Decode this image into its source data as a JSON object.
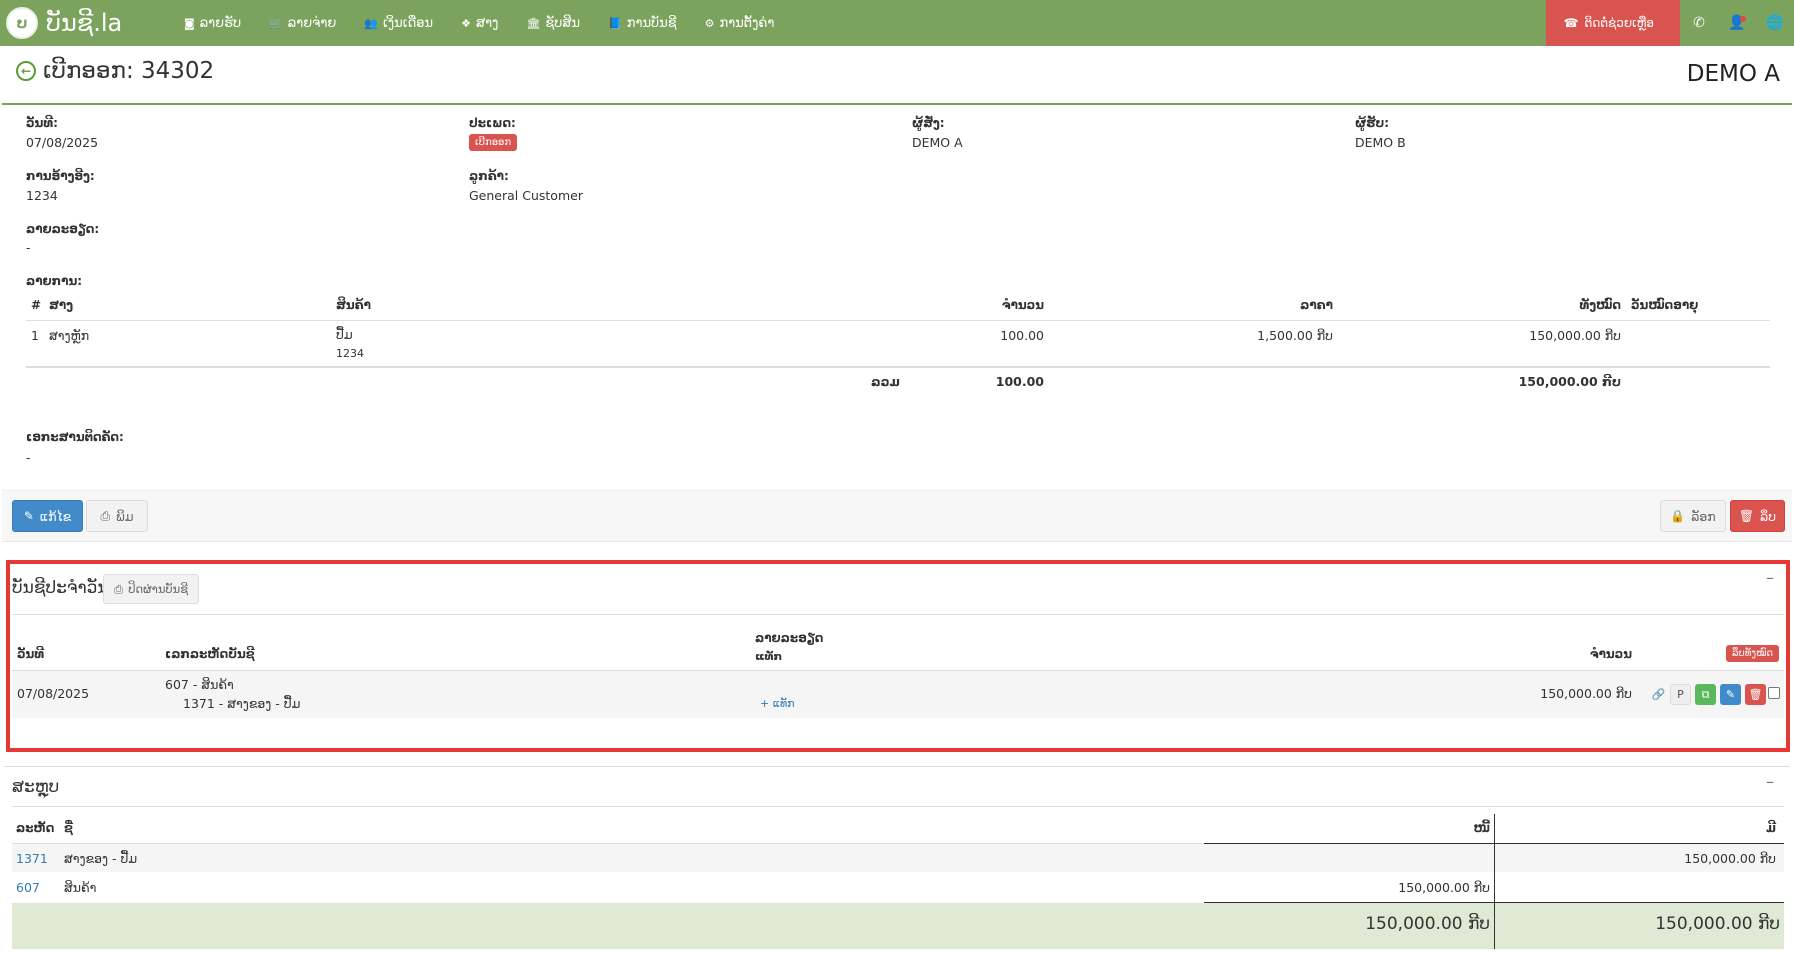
{
  "nav": {
    "brand": "ບັນຊີ.la",
    "brand_logo_letter": "ບ",
    "items": [
      {
        "icon": "camera-icon",
        "glyph": "◙",
        "label": "ລາຍຮັບ"
      },
      {
        "icon": "cart-icon",
        "glyph": "🛒",
        "label": "ລາຍຈ່າຍ"
      },
      {
        "icon": "users-icon",
        "glyph": "👥",
        "label": "ເງິນເດືອນ"
      },
      {
        "icon": "cubes-icon",
        "glyph": "❖",
        "label": "ສາງ"
      },
      {
        "icon": "bank-icon",
        "glyph": "🏛",
        "label": "ຊັບສິນ"
      },
      {
        "icon": "book-icon",
        "glyph": "📘",
        "label": "ການບັນຊີ"
      },
      {
        "icon": "cogs-icon",
        "glyph": "⚙",
        "label": "ການຕັ້ງຄ່າ"
      }
    ],
    "help_label": "ຕິດຕໍ່ຊ່ວຍເຫຼືອ"
  },
  "header": {
    "title": "ເບີກອອກ: 34302",
    "company": "DEMO A"
  },
  "info": {
    "date_label": "ວັນທີ:",
    "date": "07/08/2025",
    "type_label": "ປະເພດ:",
    "type_badge": "ເບີກອອກ",
    "buyer_label": "ຜູ້ສັ່ງ:",
    "buyer": "DEMO A",
    "receiver_label": "ຜູ້ຮັບ:",
    "receiver": "DEMO B",
    "ref_label": "ການອ້າງອີງ:",
    "ref": "1234",
    "customer_label": "ລູກຄ້າ:",
    "customer": "General Customer",
    "desc_label": "ລາຍລະອຽດ:",
    "desc": "-",
    "items_label": "ລາຍການ:",
    "attach_label": "ເອກະສານຕິດຄັດ:",
    "attach": "-"
  },
  "items_table": {
    "headers": {
      "num": "#",
      "warehouse": "ສາງ",
      "product": "ສິນຄ້າ",
      "qty": "ຈຳນວນ",
      "price": "ລາຄາ",
      "total": "ທັງໝົດ",
      "expiry": "ວັນໝົດອາຍຸ"
    },
    "rows": [
      {
        "num": "1",
        "warehouse": "ສາງຫຼັກ",
        "product": "ປື້ມ",
        "product_code": "1234",
        "qty": "100.00",
        "price": "1,500.00 ກີບ",
        "total": "150,000.00 ກີບ"
      }
    ],
    "footer": {
      "label": "ລວມ",
      "qty": "100.00",
      "total": "150,000.00 ກີບ"
    }
  },
  "actions": {
    "edit": "ແກ້ໄຂ",
    "print": "ພິມ",
    "lock": "ລັອກ",
    "delete": "ລຶບ"
  },
  "journal": {
    "title": "ບັນຊີປະຈຳວັນ",
    "print_button": "ປິດຜ່ານບັນຊີ",
    "headers": {
      "date": "ວັນທີ",
      "account": "ເລກລະຫັດບັນຊີ",
      "desc": "ລາຍລະອຽດ",
      "desc_sub": "ແທັກ",
      "amount": "ຈຳນວນ"
    },
    "delete_all": "ລຶບທັງໝົດ",
    "row": {
      "date": "07/08/2025",
      "account_main": "607 - ສິນຄ້າ",
      "account_sub": "1371 - ສາງຂອງ - ປື້ມ",
      "add_tag": "+ ແທັກ",
      "amount": "150,000.00 ກີບ",
      "p_label": "P"
    }
  },
  "summary": {
    "title": "ສະຫຼຸບ",
    "headers": {
      "code": "ລະຫັດ",
      "name": "ຊື່",
      "debit": "ໜີ້",
      "credit": "ມີ"
    },
    "rows": [
      {
        "code": "1371",
        "name": "ສາງຂອງ - ປື້ມ",
        "debit": "",
        "credit": "150,000.00 ກີບ"
      },
      {
        "code": "607",
        "name": "ສິນຄ້າ",
        "debit": "150,000.00 ກີບ",
        "credit": ""
      }
    ],
    "total_debit": "150,000.00 ກີບ",
    "total_credit": "150,000.00 ກີບ"
  }
}
